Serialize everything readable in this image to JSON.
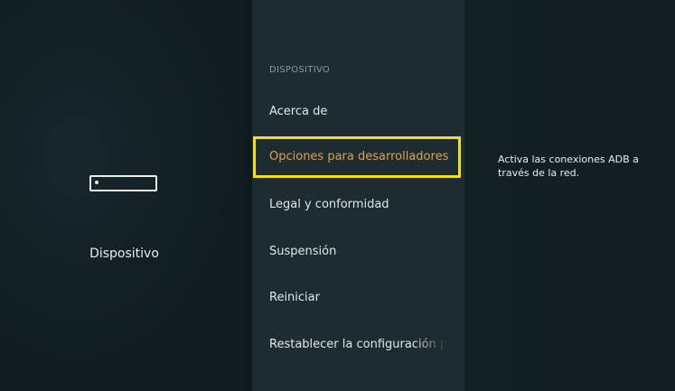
{
  "left_panel": {
    "device_icon": "streaming-device-icon",
    "label": "Dispositivo"
  },
  "menu": {
    "header": "DISPOSITIVO",
    "items": [
      {
        "label": "Acerca de"
      },
      {
        "label": "Opciones para desarrolladores",
        "selected": true
      },
      {
        "label": "Legal y conformidad"
      },
      {
        "label": "Suspensión"
      },
      {
        "label": "Reiniciar"
      },
      {
        "label": "Restablecer la configuración pr"
      }
    ]
  },
  "description": {
    "text": "Activa las conexiones ADB a través de la red."
  },
  "colors": {
    "focus_border": "#f0e400",
    "selected_text": "#e3a14a",
    "menu_background": "#1d2c30"
  }
}
